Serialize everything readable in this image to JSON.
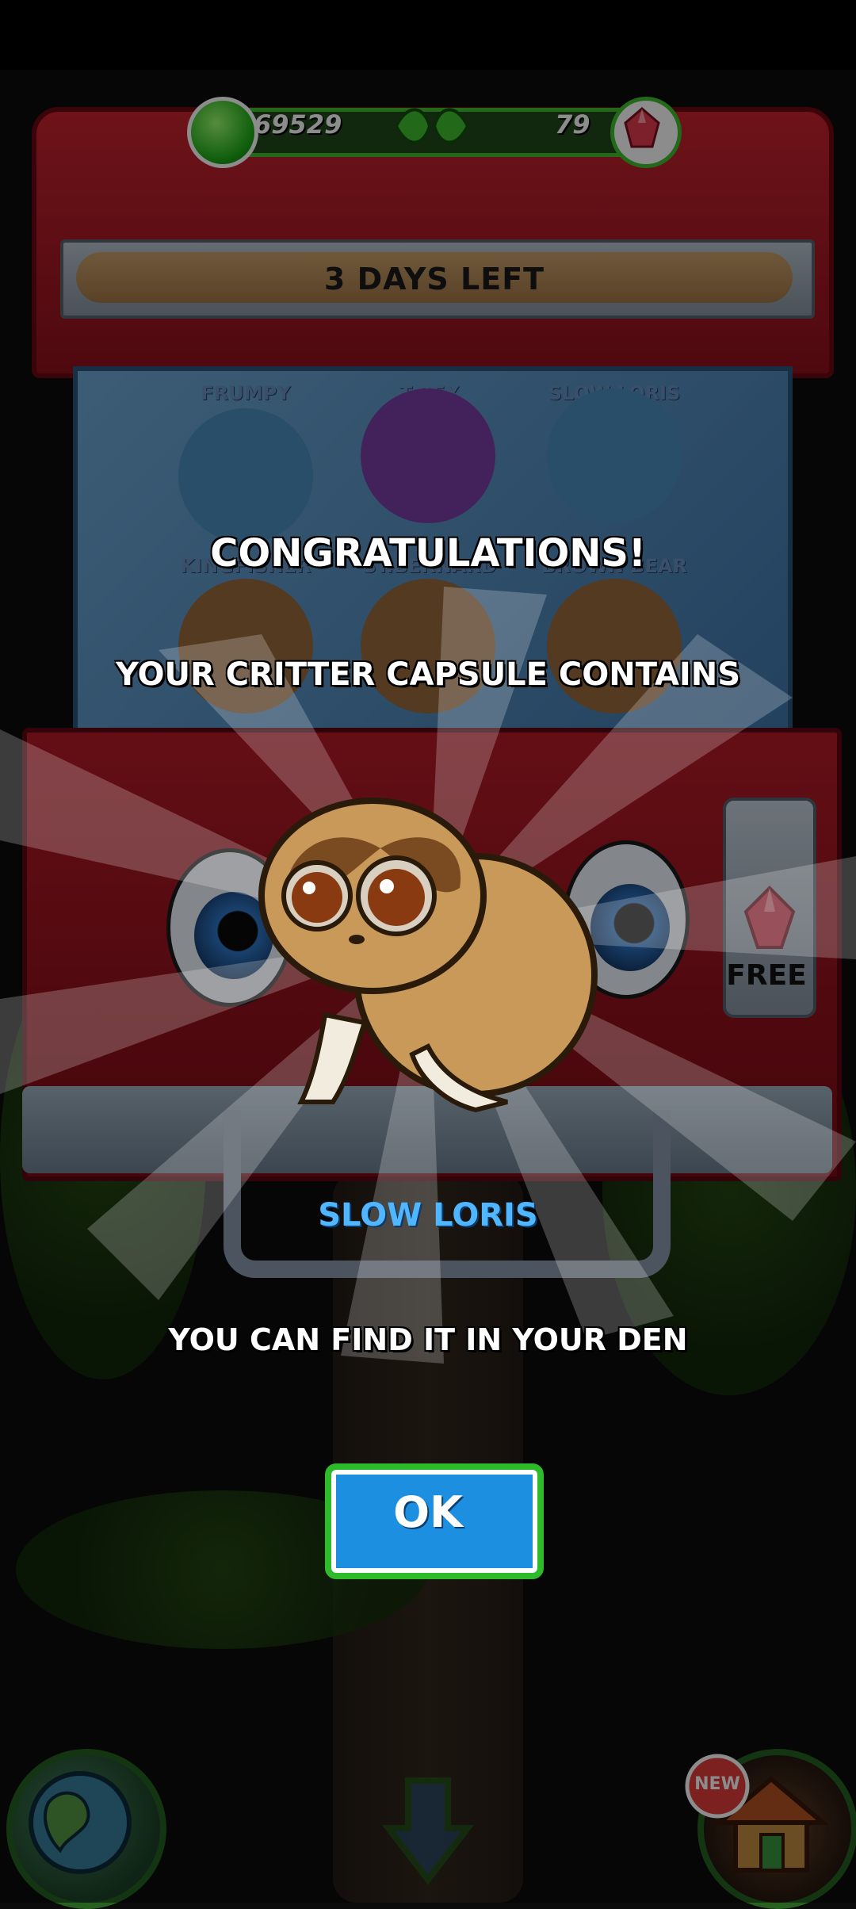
{
  "currency": {
    "coins": "69529",
    "gems": "79"
  },
  "event": {
    "timer_label": "3 DAYS LEFT"
  },
  "capsule_machine": {
    "slots": [
      {
        "label": "FRUMPY"
      },
      {
        "label": "T-REX"
      },
      {
        "label": "SLOW LORIS"
      },
      {
        "label": "KINGFISHER"
      },
      {
        "label": "ST.BERNARD"
      },
      {
        "label": "BROWN BEAR"
      }
    ],
    "free_label": "FREE"
  },
  "reward_popup": {
    "title": "CONGRATULATIONS!",
    "subtitle": "YOUR CRITTER CAPSULE CONTAINS",
    "critter_name": "SLOW LORIS",
    "message": "YOU CAN FIND IT IN YOUR DEN",
    "ok_label": "OK"
  },
  "bottom_nav": {
    "new_badge": "NEW"
  },
  "colors": {
    "machine_red": "#b51b27",
    "ok_blue": "#1c8fe0",
    "ok_border_green": "#2dbb2a",
    "critter_name_blue": "#4fb6ff"
  }
}
